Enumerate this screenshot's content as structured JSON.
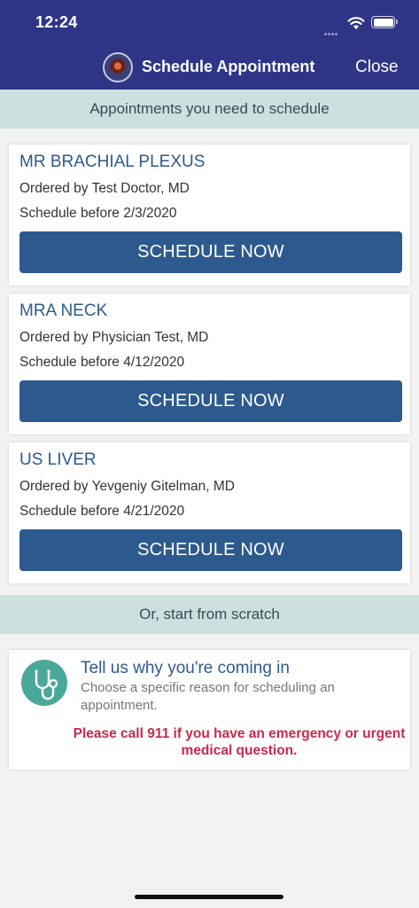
{
  "status_bar": {
    "time": "12:24"
  },
  "nav": {
    "title": "Schedule Appointment",
    "close_label": "Close"
  },
  "appointments_section": {
    "header": "Appointments you need to schedule"
  },
  "appointments": [
    {
      "name": "MR BRACHIAL PLEXUS",
      "ordered_by": "Ordered by Test Doctor, MD",
      "schedule_before": "Schedule before 2/3/2020",
      "button_label": "SCHEDULE NOW"
    },
    {
      "name": "MRA NECK",
      "ordered_by": "Ordered by Physician Test, MD",
      "schedule_before": "Schedule before 4/12/2020",
      "button_label": "SCHEDULE NOW"
    },
    {
      "name": "US LIVER",
      "ordered_by": "Ordered by Yevgeniy Gitelman, MD",
      "schedule_before": "Schedule before 4/21/2020",
      "button_label": "SCHEDULE NOW"
    }
  ],
  "scratch_section": {
    "header": "Or, start from scratch"
  },
  "reason_card": {
    "icon": "stethoscope-icon",
    "title": "Tell us why you're coming in",
    "description": "Choose a specific reason for scheduling an appointment.",
    "warning": "Please call 911 if you have an emergency or urgent medical question."
  },
  "colors": {
    "nav_background": "#2e3587",
    "section_header_background": "#cde0e0",
    "accent": "#2d5a8e",
    "icon_background": "#4aa89b",
    "warning": "#c8294f"
  }
}
